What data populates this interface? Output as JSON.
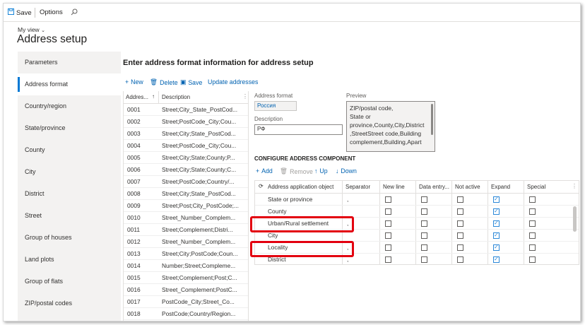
{
  "toolbar": {
    "save": "Save",
    "options": "Options"
  },
  "page": {
    "breadcrumb": "My view",
    "title": "Address setup",
    "section_title": "Enter address format information for address setup"
  },
  "sidebar": [
    "Parameters",
    "Address format",
    "Country/region",
    "State/province",
    "County",
    "City",
    "District",
    "Street",
    "Group of houses",
    "Land plots",
    "Group of flats",
    "ZIP/postal codes"
  ],
  "format_actions": {
    "new": "New",
    "delete": "Delete",
    "save": "Save",
    "update": "Update addresses"
  },
  "format_grid": {
    "col_address": "Addres...",
    "col_desc": "Description",
    "rows": [
      {
        "id": "0001",
        "desc": "Street;City_State_PostCod..."
      },
      {
        "id": "0002",
        "desc": "Street;PostCode_City;Cou..."
      },
      {
        "id": "0003",
        "desc": "Street;City;State_PostCod..."
      },
      {
        "id": "0004",
        "desc": "Street;PostCode_City;Cou..."
      },
      {
        "id": "0005",
        "desc": "Street;City;State;County;P..."
      },
      {
        "id": "0006",
        "desc": "Street;City;State;County;C..."
      },
      {
        "id": "0007",
        "desc": "Street;PostCode;Country/..."
      },
      {
        "id": "0008",
        "desc": "Street;City;State_PostCod..."
      },
      {
        "id": "0009",
        "desc": "Street;Post;City_PostCode;..."
      },
      {
        "id": "0010",
        "desc": "Street_Number_Complem..."
      },
      {
        "id": "0011",
        "desc": "Street;Complement;Distri..."
      },
      {
        "id": "0012",
        "desc": "Street_Number_Complem..."
      },
      {
        "id": "0013",
        "desc": "Street;City;PostCode;Coun..."
      },
      {
        "id": "0014",
        "desc": "Number;Street;Compleme..."
      },
      {
        "id": "0015",
        "desc": "Street;Complement;Post;C..."
      },
      {
        "id": "0016",
        "desc": "Street_Complement;PostC..."
      },
      {
        "id": "0017",
        "desc": "PostCode_City;Street_Co..."
      },
      {
        "id": "0018",
        "desc": "PostCode;Country/Region..."
      }
    ]
  },
  "form": {
    "format_label": "Address format",
    "format_value": "Россия",
    "desc_label": "Description",
    "desc_value": "РФ",
    "preview_label": "Preview",
    "preview_lines": [
      "ZIP/postal code,",
      "State or",
      "province,County,City,District",
      ",StreetStreet code,Building",
      "complement,Building,Apart"
    ]
  },
  "component": {
    "title": "CONFIGURE ADDRESS COMPONENT",
    "add": "Add",
    "remove": "Remove",
    "up": "Up",
    "down": "Down",
    "cols": [
      "Address application object",
      "Separator",
      "New line",
      "Data entry...",
      "Not active",
      "Expand",
      "Special"
    ],
    "rows": [
      {
        "name": "State or province",
        "sep": ",",
        "expand": true
      },
      {
        "name": "County",
        "sep": "",
        "expand": true
      },
      {
        "name": "Urban/Rural settlement",
        "sep": ",",
        "expand": true
      },
      {
        "name": "City",
        "sep": "",
        "expand": true
      },
      {
        "name": "Locality",
        "sep": ",",
        "expand": true
      },
      {
        "name": "District",
        "sep": ",",
        "expand": true
      }
    ]
  },
  "colors": {
    "accent": "#0078d4",
    "highlight": "#e3000f"
  }
}
